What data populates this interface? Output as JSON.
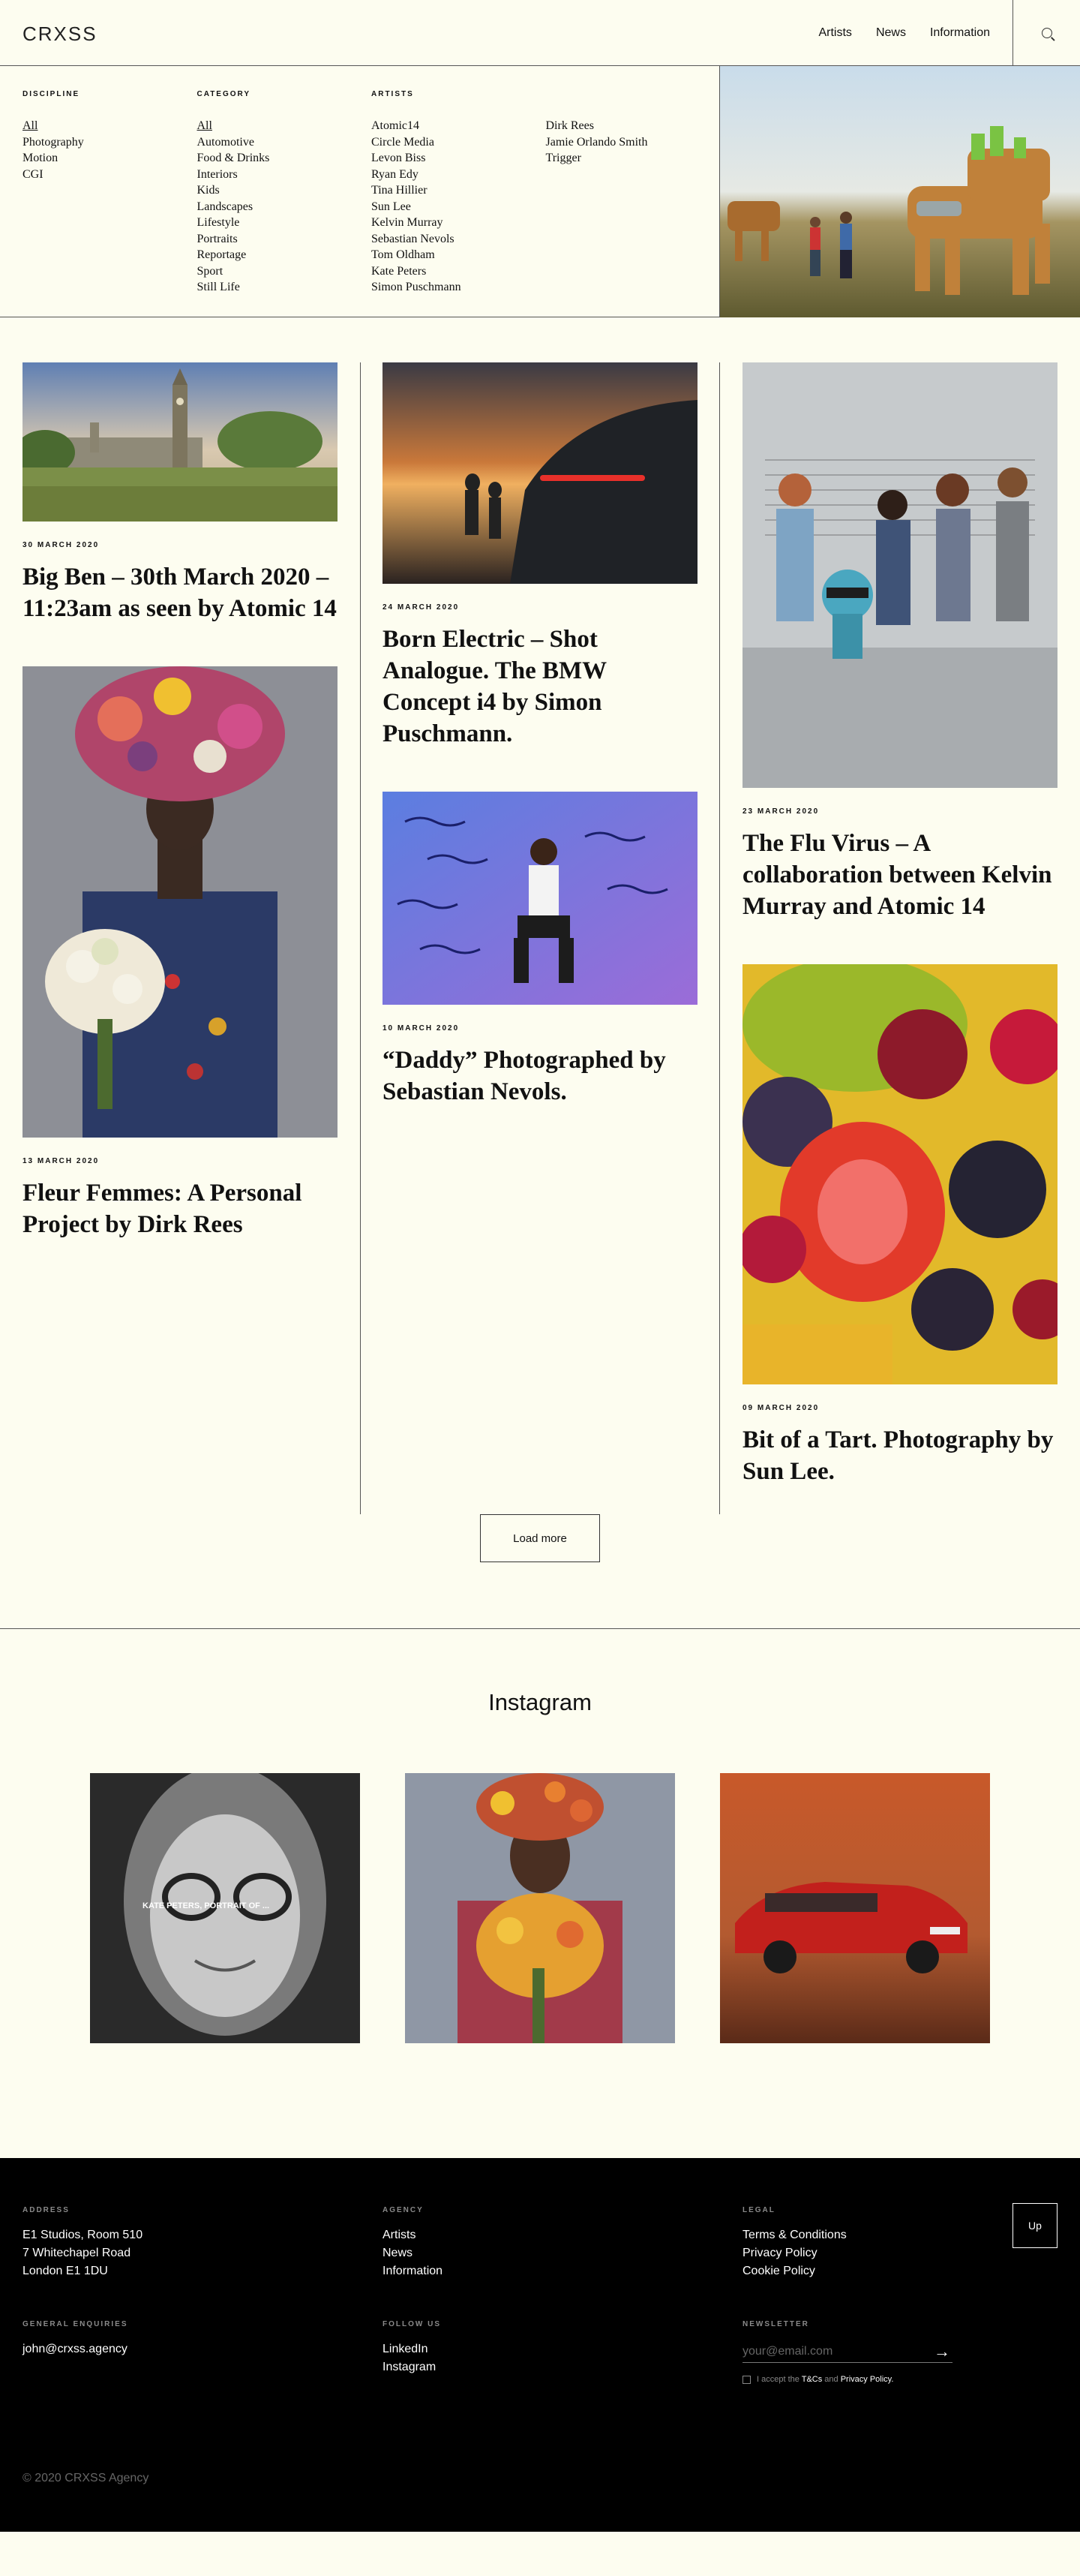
{
  "header": {
    "logo": "CRXSS",
    "nav": [
      "Artists",
      "News",
      "Information"
    ]
  },
  "filters": {
    "discipline": {
      "heading": "DISCIPLINE",
      "items": [
        "All",
        "Photography",
        "Motion",
        "CGI"
      ]
    },
    "category": {
      "heading": "CATEGORY",
      "items": [
        "All",
        "Automotive",
        "Food & Drinks",
        "Interiors",
        "Kids",
        "Landscapes",
        "Lifestyle",
        "Portraits",
        "Reportage",
        "Sport",
        "Still Life"
      ]
    },
    "artists": {
      "heading": "ARTISTS",
      "items": [
        "Atomic14",
        "Circle Media",
        "Levon Biss",
        "Ryan Edy",
        "Tina Hillier",
        "Sun Lee",
        "Kelvin Murray",
        "Sebastian Nevols",
        "Tom Oldham",
        "Kate Peters",
        "Simon Puschmann"
      ],
      "items2": [
        "Dirk Rees",
        "Jamie Orlando Smith",
        "Trigger"
      ]
    }
  },
  "posts": {
    "p1": {
      "date": "30 MARCH 2020",
      "title": "Big Ben – 30th March 2020 – 11:23am as seen by Atomic 14"
    },
    "p2": {
      "date": "13 MARCH 2020",
      "title": "Fleur Femmes: A Personal Project by Dirk Rees"
    },
    "p3": {
      "date": "24 MARCH 2020",
      "title": "Born Electric – Shot Analogue. The BMW Concept i4 by Simon Puschmann."
    },
    "p4": {
      "date": "10 MARCH 2020",
      "title": "“Daddy” Photographed by Sebastian Nevols."
    },
    "p5": {
      "date": "23 MARCH 2020",
      "title": "The Flu Virus – A collaboration between Kelvin Murray and Atomic 14"
    },
    "p6": {
      "date": "09 MARCH 2020",
      "title": "Bit of a Tart. Photography by Sun Lee."
    }
  },
  "load_more": "Load more",
  "instagram": {
    "heading": "Instagram",
    "overlay_caption": "KATE PETERS, PORTRAIT OF ..."
  },
  "footer": {
    "address": {
      "heading": "ADDRESS",
      "lines": [
        "E1 Studios, Room 510",
        "7 Whitechapel Road",
        "London E1 1DU"
      ]
    },
    "agency": {
      "heading": "AGENCY",
      "links": [
        "Artists",
        "News",
        "Information"
      ]
    },
    "legal": {
      "heading": "LEGAL",
      "links": [
        "Terms & Conditions",
        "Privacy Policy",
        "Cookie Policy"
      ]
    },
    "enquiries": {
      "heading": "GENERAL ENQUIRIES",
      "email": "john@crxss.agency"
    },
    "follow": {
      "heading": "FOLLOW US",
      "links": [
        "LinkedIn",
        "Instagram"
      ]
    },
    "newsletter": {
      "heading": "NEWSLETTER",
      "placeholder": "your@email.com",
      "consent_prefix": "I accept the",
      "consent_tcs": "T&Cs",
      "consent_and": "and",
      "consent_privacy": "Privacy Policy."
    },
    "up_label": "Up",
    "copyright": "© 2020 CRXSS Agency"
  }
}
